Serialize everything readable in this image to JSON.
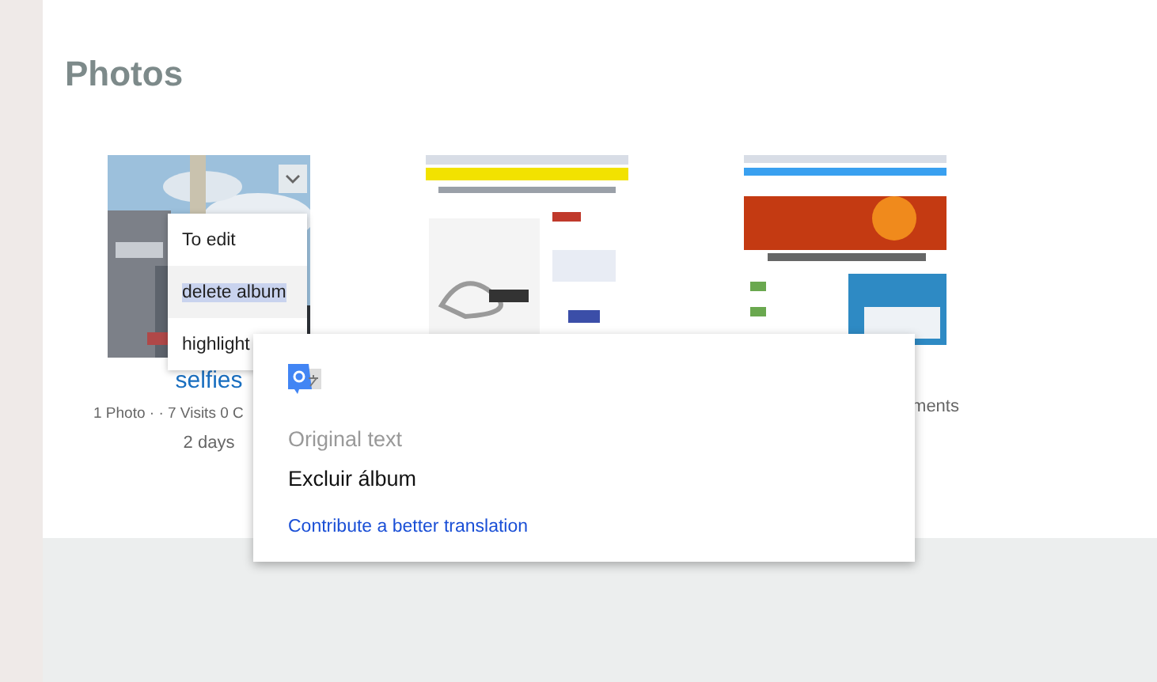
{
  "heading": "Photos",
  "albums": [
    {
      "thumbnail": {
        "kind": "picture"
      },
      "title": "selfies",
      "meta": [
        "1 Photo · · 7 Visits 0 C",
        "2 days"
      ]
    },
    {
      "thumbnail": {
        "kind": "picture"
      }
    },
    {
      "thumbnail": {
        "kind": "picture"
      },
      "meta": [
        "ments"
      ]
    }
  ],
  "album_menu": {
    "items": [
      {
        "label": "To edit",
        "hovered": false
      },
      {
        "label": "delete album",
        "hovered": true
      },
      {
        "label": "highlight",
        "hovered": false
      }
    ]
  },
  "translation_popup": {
    "label": "Original text",
    "original": "Excluir álbum",
    "link": "Contribute a better translation"
  }
}
